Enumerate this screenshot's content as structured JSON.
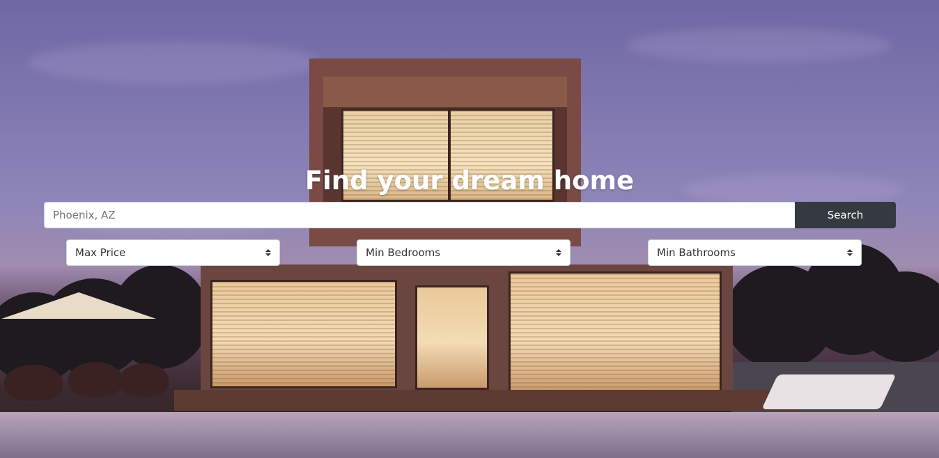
{
  "hero": {
    "title": "Find your dream home",
    "background_image": "modern-house-at-dusk"
  },
  "search": {
    "placeholder": "Phoenix, AZ",
    "value": "",
    "button_label": "Search"
  },
  "filters": {
    "max_price": "Max Price",
    "min_bedrooms": "Min Bedrooms",
    "min_bathrooms": "Min Bathrooms"
  },
  "colors": {
    "button_dark": "#343a40",
    "title_text": "#ffffff"
  }
}
